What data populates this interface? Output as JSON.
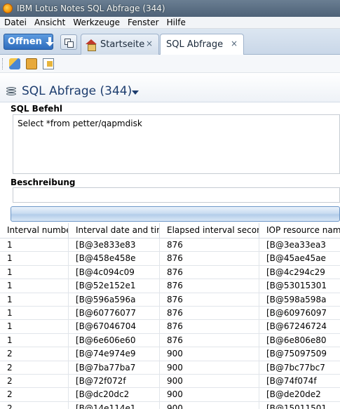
{
  "window": {
    "title": "IBM Lotus Notes SQL Abfrage (344)"
  },
  "menu": [
    "Datei",
    "Ansicht",
    "Werkzeuge",
    "Fenster",
    "Hilfe"
  ],
  "tabs": {
    "open_label": "Offnen",
    "home_label": "Startseite",
    "sql_label": "SQL Abfrage",
    "close_glyph": "×"
  },
  "page": {
    "title": "SQL Abfrage (344)"
  },
  "form": {
    "sql_label": "SQL Befehl",
    "sql_value": "Select *from petter/qapmdisk",
    "desc_label": "Beschreibung",
    "desc_value": ""
  },
  "table": {
    "columns": [
      "Interval number",
      "Interval date and time",
      "Elapsed interval seconds",
      "IOP resource name"
    ],
    "rows": [
      [
        "1",
        "[B@3e833e83",
        "876",
        "[B@3ea33ea3"
      ],
      [
        "1",
        "[B@458e458e",
        "876",
        "[B@45ae45ae"
      ],
      [
        "1",
        "[B@4c094c09",
        "876",
        "[B@4c294c29"
      ],
      [
        "1",
        "[B@52e152e1",
        "876",
        "[B@53015301"
      ],
      [
        "1",
        "[B@596a596a",
        "876",
        "[B@598a598a"
      ],
      [
        "1",
        "[B@60776077",
        "876",
        "[B@60976097"
      ],
      [
        "1",
        "[B@67046704",
        "876",
        "[B@67246724"
      ],
      [
        "1",
        "[B@6e606e60",
        "876",
        "[B@6e806e80"
      ],
      [
        "2",
        "[B@74e974e9",
        "900",
        "[B@75097509"
      ],
      [
        "2",
        "[B@7ba77ba7",
        "900",
        "[B@7bc77bc7"
      ],
      [
        "2",
        "[B@72f072f",
        "900",
        "[B@74f074f"
      ],
      [
        "2",
        "[B@dc20dc2",
        "900",
        "[B@de20de2"
      ],
      [
        "2",
        "[B@14e114e1",
        "900",
        "[B@15011501"
      ]
    ]
  }
}
